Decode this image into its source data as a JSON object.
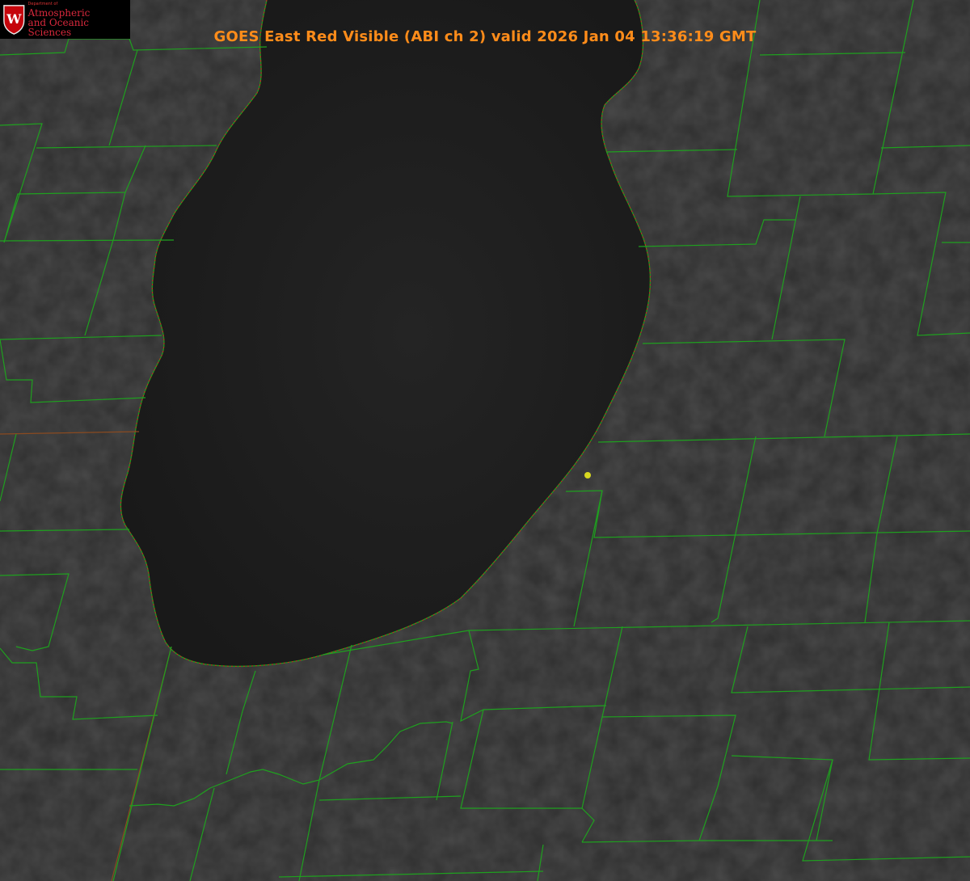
{
  "title": "GOES East Red Visible (ABI ch 2) valid 2026 Jan 04 13:36:19 GMT",
  "logo": {
    "department": "Department of",
    "line1": "Atmospheric",
    "line2": "and Oceanic Sciences",
    "crest_letter": "W"
  },
  "colors": {
    "title": "#ff8c1a",
    "county_lines": "#1fa01f",
    "shoreline_dashed": "#d02020",
    "marker": "#d8d820",
    "land": "#2f2f2f",
    "lake": "#1b1b1b"
  },
  "layers": [
    "satellite-visible",
    "county-boundaries",
    "state-boundaries",
    "shoreline",
    "point-marker"
  ]
}
